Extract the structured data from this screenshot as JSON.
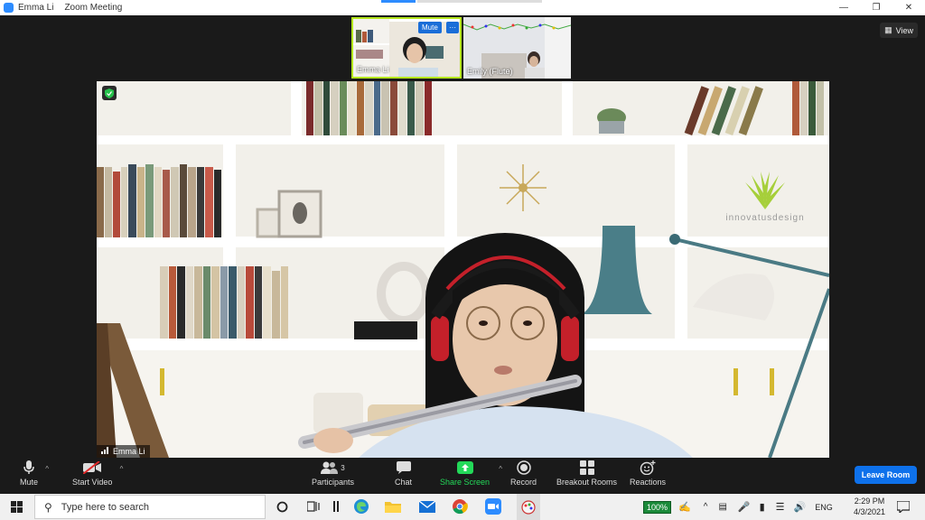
{
  "window": {
    "name": "Emma Li",
    "title": "Zoom Meeting"
  },
  "view_label": "View",
  "thumbnails": [
    {
      "name": "Emma Li",
      "mute_label": "Mute",
      "more_label": "···"
    },
    {
      "name": "Emily (Flute)"
    }
  ],
  "main_video": {
    "speaker_name": "Emma Li",
    "wall_logo_text": "innovatusdesign"
  },
  "toolbar": {
    "mute_label": "Mute",
    "start_video_label": "Start Video",
    "participants_label": "Participants",
    "participants_count": "3",
    "chat_label": "Chat",
    "share_screen_label": "Share Screen",
    "record_label": "Record",
    "breakout_label": "Breakout Rooms",
    "reactions_label": "Reactions",
    "leave_label": "Leave Room"
  },
  "taskbar": {
    "search_placeholder": "Type here to search",
    "battery_percent": "100%",
    "language": "ENG",
    "time": "2:29 PM",
    "date": "4/3/2021"
  },
  "colors": {
    "zoom_blue": "#2D8CFF",
    "leave_blue": "#0e71eb",
    "share_green": "#23d959",
    "active_speaker_border": "#b5e61d"
  }
}
